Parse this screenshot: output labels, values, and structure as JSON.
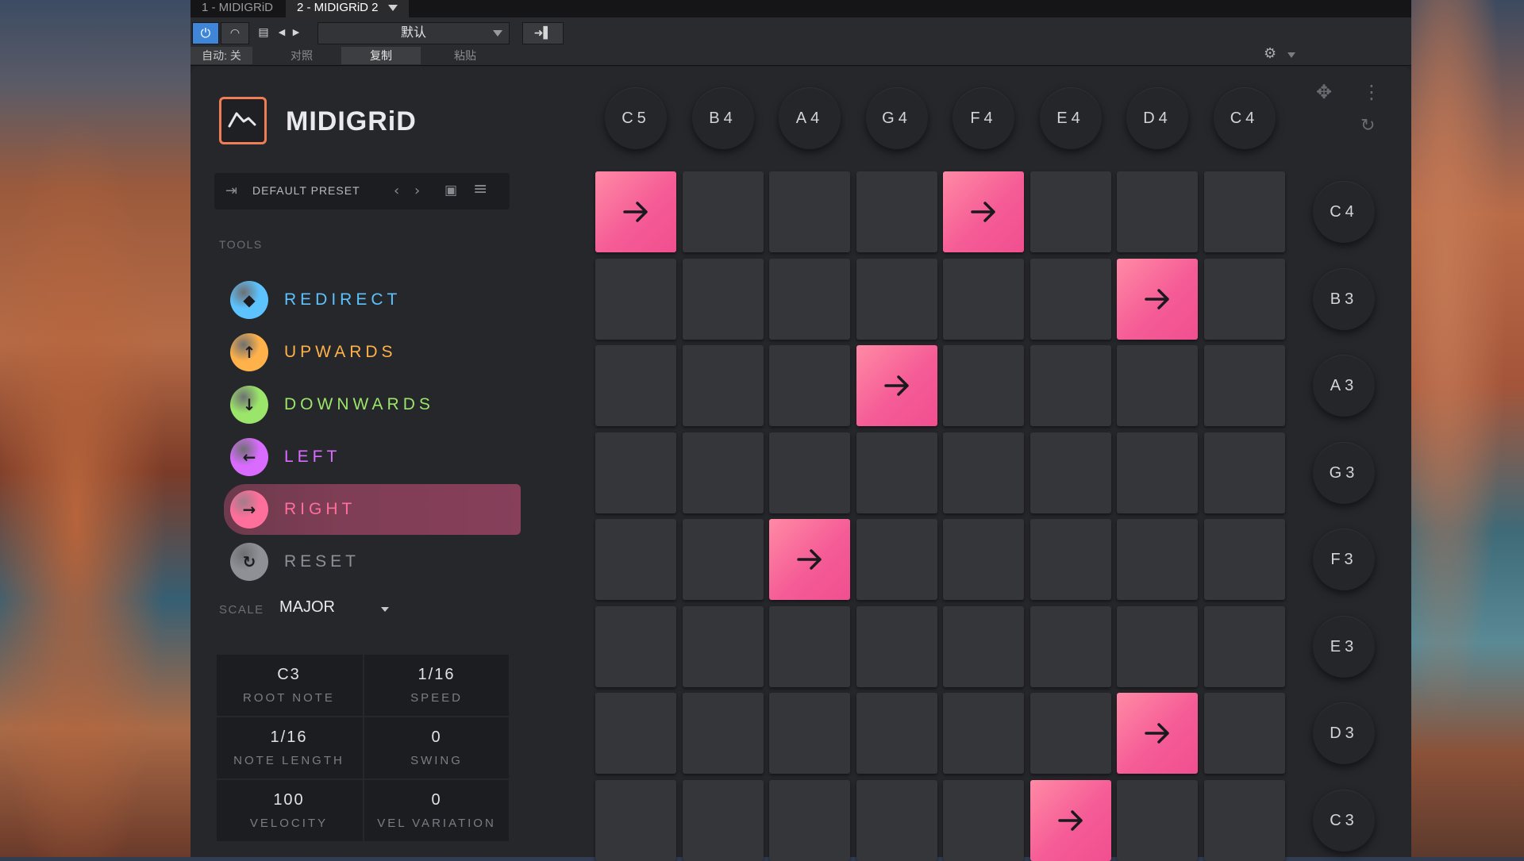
{
  "host": {
    "tabs": [
      "1 - MIDIGRiD",
      "2 - MIDIGRiD 2"
    ],
    "preset_name": "默认",
    "auto_label": "自动: 关",
    "compare_label": "对照",
    "copy_label": "复制",
    "paste_label": "粘贴"
  },
  "plugin": {
    "logo_text": "MIDIGRiD",
    "preset_label": "DEFAULT PRESET",
    "tools_heading": "TOOLS",
    "tools": [
      {
        "label": "REDIRECT",
        "color": "#5cc3ff",
        "icon": "diamond-icon",
        "glyph": "◆"
      },
      {
        "label": "UPWARDS",
        "color": "#ffb14a",
        "icon": "arrow-up-icon",
        "glyph": "↑"
      },
      {
        "label": "DOWNWARDS",
        "color": "#9be56a",
        "icon": "arrow-down-icon",
        "glyph": "↓"
      },
      {
        "label": "LEFT",
        "color": "#d96cff",
        "icon": "arrow-left-icon",
        "glyph": "←"
      },
      {
        "label": "RIGHT",
        "color": "#ff6f9b",
        "icon": "arrow-right-icon",
        "glyph": "→",
        "selected": true
      },
      {
        "label": "RESET",
        "color": "#8f9096",
        "icon": "reset-icon",
        "glyph": "↻"
      }
    ],
    "scale_label": "SCALE",
    "scale_value": "MAJOR",
    "params": [
      {
        "value": "C3",
        "label": "ROOT NOTE"
      },
      {
        "value": "1/16",
        "label": "SPEED"
      },
      {
        "value": "1/16",
        "label": "NOTE LENGTH"
      },
      {
        "value": "0",
        "label": "SWING"
      },
      {
        "value": "100",
        "label": "VELOCITY"
      },
      {
        "value": "0",
        "label": "VEL VARIATION"
      }
    ],
    "column_notes": [
      "C5",
      "B4",
      "A4",
      "G4",
      "F4",
      "E4",
      "D4",
      "C4"
    ],
    "row_notes": [
      "C4",
      "B3",
      "A3",
      "G3",
      "F3",
      "E3",
      "D3",
      "C3"
    ],
    "grid_active": [
      [
        0,
        0
      ],
      [
        0,
        4
      ],
      [
        1,
        6
      ],
      [
        2,
        3
      ],
      [
        4,
        2
      ],
      [
        6,
        6
      ],
      [
        7,
        5
      ]
    ]
  },
  "colors": {
    "accent_pink": "#f55c96",
    "accent_orange": "#f07d56",
    "panel": "#26272b"
  }
}
